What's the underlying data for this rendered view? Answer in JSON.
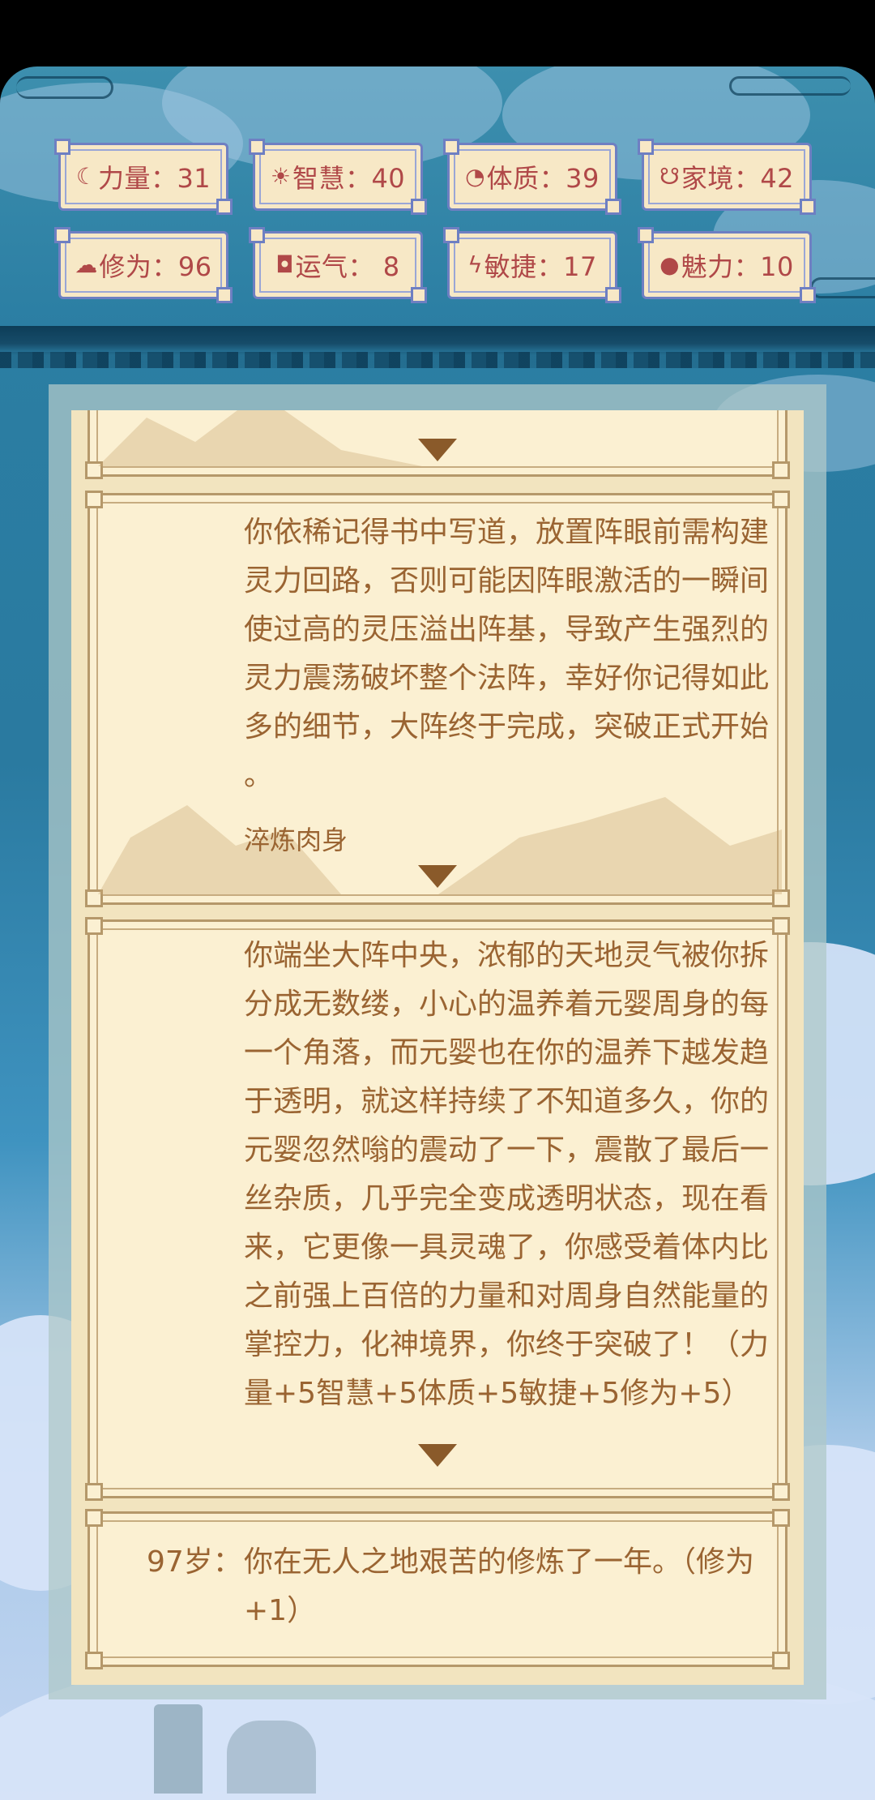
{
  "stats": [
    {
      "icon": "strength-icon",
      "glyph": "☾",
      "text": "力量：31"
    },
    {
      "icon": "wisdom-icon",
      "glyph": "☀",
      "text": "智慧：40"
    },
    {
      "icon": "constitution-icon",
      "glyph": "◔",
      "text": "体质：39"
    },
    {
      "icon": "family-icon",
      "glyph": "☋",
      "text": "家境：42"
    },
    {
      "icon": "cultivation-icon",
      "glyph": "☁",
      "text": "修为：96"
    },
    {
      "icon": "luck-icon",
      "glyph": "◘",
      "text": "运气： 8"
    },
    {
      "icon": "agility-icon",
      "glyph": "ϟ",
      "text": "敏捷：17"
    },
    {
      "icon": "charm-icon",
      "glyph": "●",
      "text": "魅力：10"
    }
  ],
  "events": [
    {
      "age": "",
      "lines": [],
      "note": ""
    },
    {
      "age": "",
      "lines": [
        "你依稀记得书中写道，放置阵眼前需构建",
        "灵力回路，否则可能因阵眼激活的一瞬间",
        "使过高的灵压溢出阵基，导致产生强烈的",
        "灵力震荡破坏整个法阵，幸好你记得如此",
        "多的细节，大阵终于完成，突破正式开始",
        "。"
      ],
      "note": "淬炼肉身"
    },
    {
      "age": "",
      "lines": [
        "你端坐大阵中央，浓郁的天地灵气被你拆",
        "分成无数缕，小心的温养着元婴周身的每",
        "一个角落，而元婴也在你的温养下越发趋",
        "于透明，就这样持续了不知道多久，你的",
        "元婴忽然嗡的震动了一下，震散了最后一",
        "丝杂质，几乎完全变成透明状态，现在看",
        "来，它更像一具灵魂了，你感受着体内比",
        "之前强上百倍的力量和对周身自然能量的",
        "掌控力，化神境界，你终于突破了！（力",
        "量+5智慧+5体质+5敏捷+5修为+5）"
      ],
      "note": ""
    },
    {
      "age": "97岁：",
      "lines": [
        "你在无人之地艰苦的修炼了一年。（修为",
        "+1）"
      ],
      "note": ""
    }
  ],
  "colors": {
    "stat_text": "#b04848",
    "story_text": "#9a6432",
    "card_bg": "#fbf0d2",
    "frame": "#b5986a",
    "sky_blue": "#2b7ea3"
  }
}
